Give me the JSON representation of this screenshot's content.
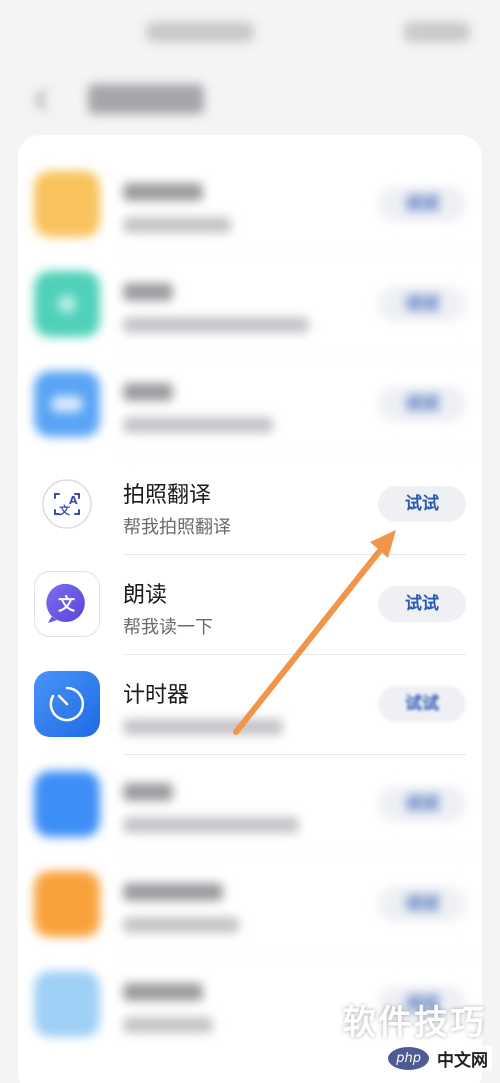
{
  "status_bar": {
    "time": "",
    "icons": ""
  },
  "header": {
    "title": ""
  },
  "list": {
    "try_label": "试试",
    "items": [
      {
        "title": "",
        "subtitle": "",
        "icon": "folder-icon",
        "color": "#f9c25c",
        "blurred": true
      },
      {
        "title": "",
        "subtitle": "",
        "icon": "app-icon",
        "color": "#4fd1b9",
        "blurred": true
      },
      {
        "title": "",
        "subtitle": "",
        "icon": "weather-icon",
        "color": "#5aa4f5",
        "blurred": true
      },
      {
        "title": "拍照翻译",
        "subtitle": "帮我拍照翻译",
        "icon": "photo-translate-icon",
        "color": "#ffffff",
        "blurred": false
      },
      {
        "title": "朗读",
        "subtitle": "帮我读一下",
        "icon": "read-aloud-icon",
        "color": "#ffffff",
        "blurred": false
      },
      {
        "title": "计时器",
        "subtitle": "",
        "icon": "timer-icon",
        "color": "#2f7ef1",
        "blurred": false
      },
      {
        "title": "",
        "subtitle": "",
        "icon": "app-icon",
        "color": "#3d8ef6",
        "blurred": true
      },
      {
        "title": "",
        "subtitle": "",
        "icon": "app-icon",
        "color": "#f9a23c",
        "blurred": true
      },
      {
        "title": "",
        "subtitle": "",
        "icon": "app-icon",
        "color": "#9fd0f5",
        "blurred": true
      }
    ]
  },
  "watermark": {
    "text": "软件技巧",
    "logo_badge": "php",
    "logo_site": "中文网"
  },
  "colors": {
    "accent": "#2a58b3",
    "arrow": "#f0954a",
    "background": "#f4f4f5"
  }
}
